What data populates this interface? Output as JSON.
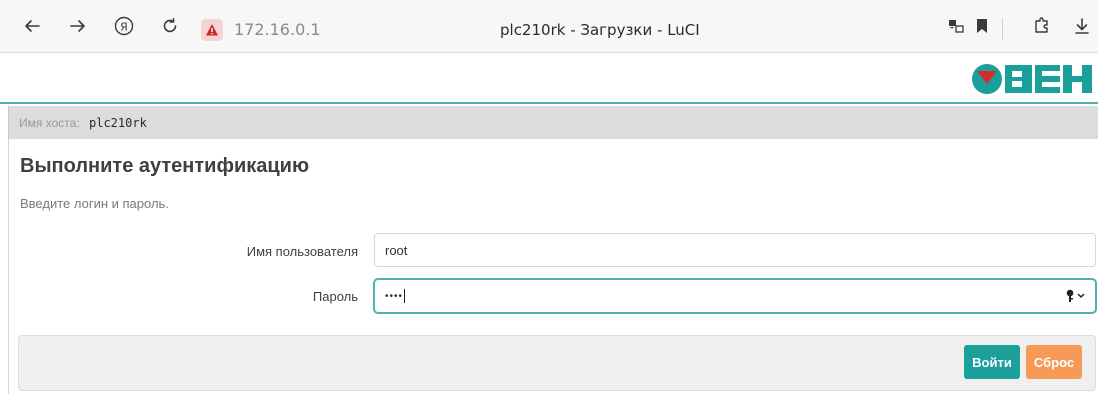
{
  "browser": {
    "url": "172.16.0.1",
    "tab_title": "plc210rk - Загрузки - LuCI",
    "icons": [
      "back-arrow-icon",
      "forward-arrow-icon",
      "yandex-icon",
      "reload-icon",
      "warning-icon",
      "translate-icon",
      "bookmark-icon",
      "extension-icon",
      "download-icon"
    ]
  },
  "header": {
    "logo_text": "ОВЕН",
    "brand_color": "#1b9f9a",
    "logo_red": "#d92a2a"
  },
  "hostname": {
    "label": "Имя хоста:",
    "value": "plc210rk"
  },
  "auth": {
    "title": "Выполните аутентификацию",
    "description": "Введите логин и пароль.",
    "username_label": "Имя пользователя",
    "username_value": "root",
    "password_label": "Пароль",
    "password_value": "••••"
  },
  "actions": {
    "login_label": "Войти",
    "reset_label": "Сброс",
    "login_color": "#1b9f9a",
    "reset_color": "#f79a57"
  }
}
